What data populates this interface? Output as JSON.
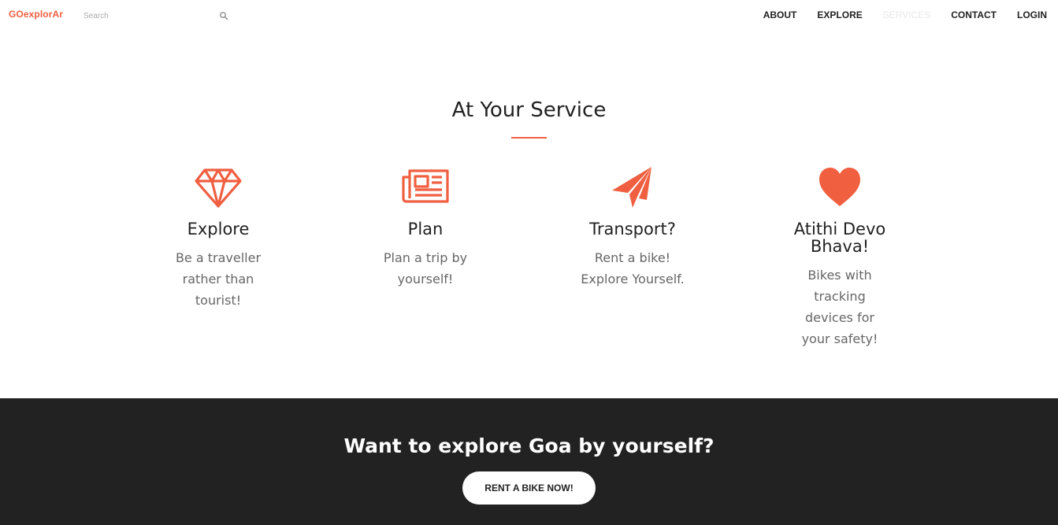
{
  "nav": {
    "brand": "GOexplorAr",
    "search": {
      "placeholder": "Search",
      "icon": "search-icon"
    },
    "links": [
      {
        "label": "ABOUT",
        "active": false
      },
      {
        "label": "EXPLORE",
        "active": false
      },
      {
        "label": "SERVICES",
        "active": true
      },
      {
        "label": "CONTACT",
        "active": false
      },
      {
        "label": "LOGIN",
        "active": false
      }
    ]
  },
  "services": {
    "title": "At Your Service",
    "items": [
      {
        "icon": "diamond-icon",
        "name": "Explore",
        "desc": "Be a traveller rather than tourist!"
      },
      {
        "icon": "newspaper-icon",
        "name": "Plan",
        "desc": "Plan a trip by yourself!"
      },
      {
        "icon": "paper-plane-icon",
        "name": "Transport?",
        "desc": "Rent a bike! Explore Yourself."
      },
      {
        "icon": "heart-icon",
        "name": "Atithi Devo Bhava!",
        "desc": "Bikes with tracking devices for your safety!"
      }
    ]
  },
  "cta": {
    "heading": "Want to explore Goa by yourself?",
    "button": "RENT A BIKE NOW!"
  },
  "colors": {
    "accent": "#f05f40",
    "dark": "#222222",
    "text": "#222222",
    "muted": "#666666"
  }
}
